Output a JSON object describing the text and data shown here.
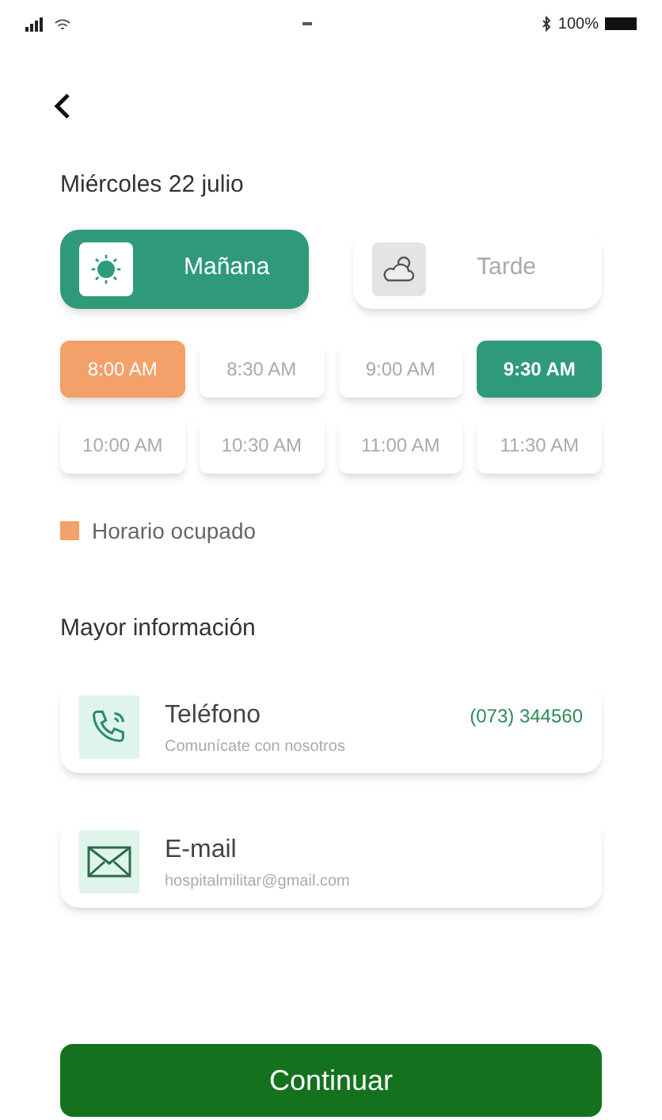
{
  "status_bar": {
    "battery_text": "100%"
  },
  "date_title": "Miércoles 22 julio",
  "periods": [
    {
      "label": "Mañana",
      "kind": "sun",
      "selected": true
    },
    {
      "label": "Tarde",
      "kind": "cloud",
      "selected": false
    }
  ],
  "slots": [
    {
      "label": "8:00 AM",
      "busy": true,
      "selected": false
    },
    {
      "label": "8:30 AM",
      "busy": false,
      "selected": false
    },
    {
      "label": "9:00 AM",
      "busy": false,
      "selected": false
    },
    {
      "label": "9:30 AM",
      "busy": false,
      "selected": true
    },
    {
      "label": "10:00 AM",
      "busy": false,
      "selected": false
    },
    {
      "label": "10:30 AM",
      "busy": false,
      "selected": false
    },
    {
      "label": "11:00 AM",
      "busy": false,
      "selected": false
    },
    {
      "label": "11:30 AM",
      "busy": false,
      "selected": false
    }
  ],
  "legend": {
    "label": "Horario ocupado",
    "color": "#f4a06a"
  },
  "info_title": "Mayor información",
  "contacts": [
    {
      "kind": "phone",
      "title": "Teléfono",
      "subtitle": "Comunícate con nosotros",
      "value": "(073) 344560"
    },
    {
      "kind": "email",
      "title": "E-mail",
      "subtitle": "hospitalmilitar@gmail.com"
    }
  ],
  "continue_button": "Continuar"
}
